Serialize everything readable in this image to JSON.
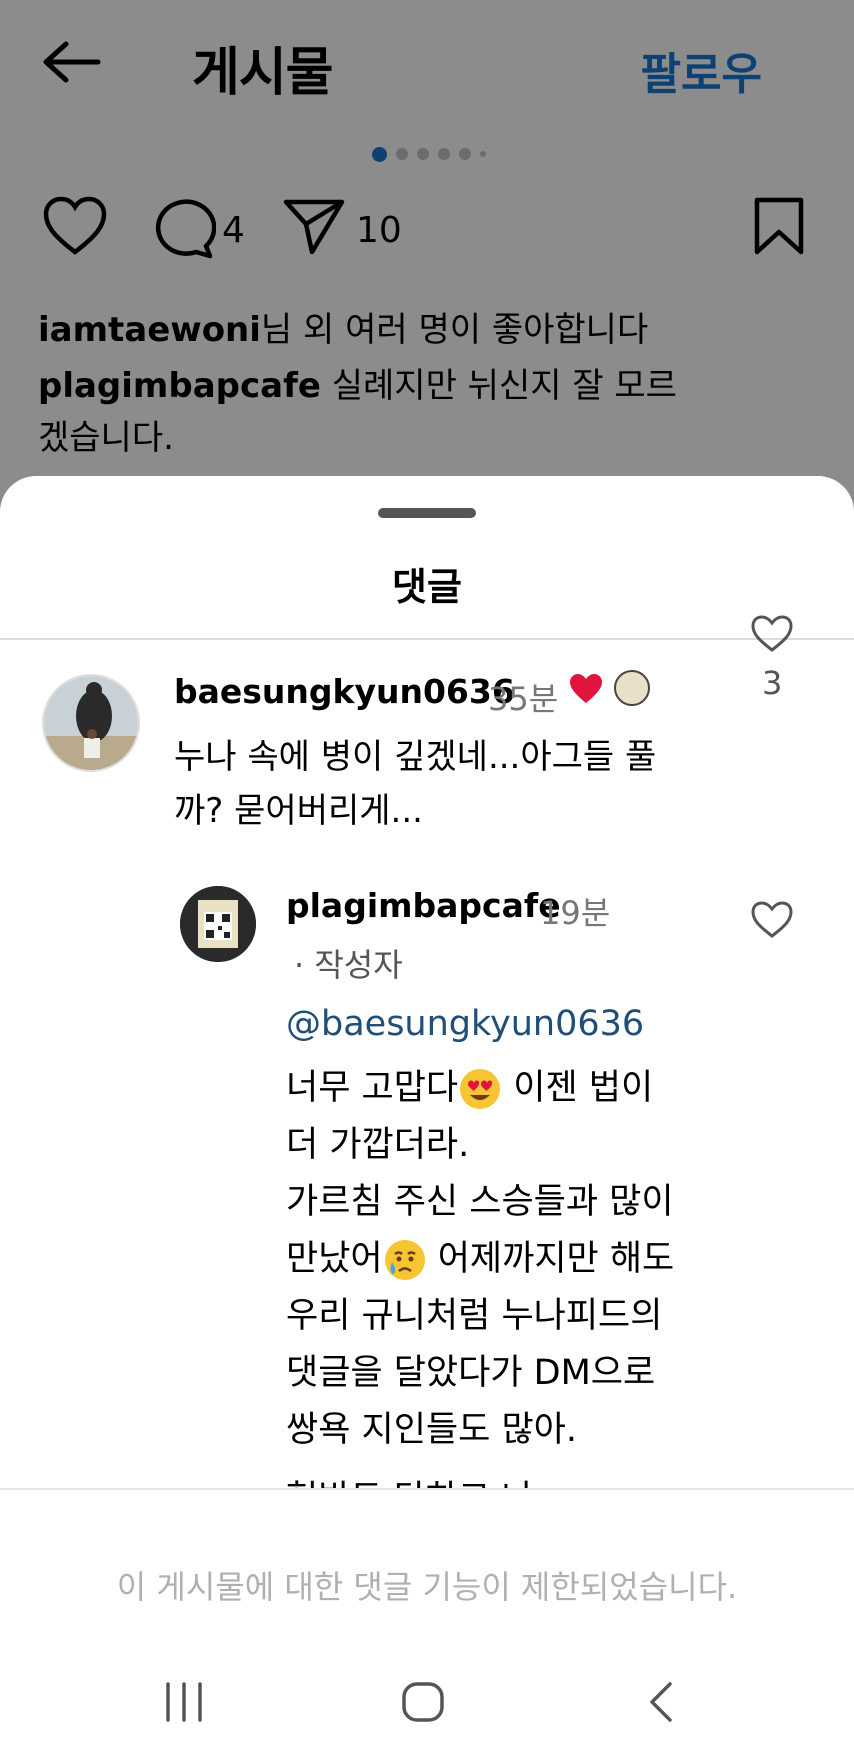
{
  "header": {
    "title": "게시물",
    "follow_label": "팔로우"
  },
  "post": {
    "comment_count": "4",
    "share_count": "10",
    "likes_user": "iamtaewoni",
    "likes_suffix": "님 외 여러 명이 좋아합니다",
    "caption_user": "plagimbapcafe",
    "caption_text": " 실례지만 뉘신지 잘 모르겠습니다."
  },
  "sheet": {
    "title": "댓글",
    "restricted_notice": "이 게시물에 대한 댓글 기능이 제한되었습니다."
  },
  "comments": [
    {
      "username": "baesungkyun0636",
      "time": "35분",
      "text": "누나 속에 병이 깊겠네...아그들 풀까? 묻어버리게...",
      "like_count": "3"
    }
  ],
  "reply": {
    "username": "plagimbapcafe",
    "time": "19분",
    "author_tag": "· 작성자",
    "mention": "@baesungkyun0636",
    "line1_a": "너무 고맙다",
    "line1_b": " 이젠 법이",
    "line2": "더 가깝더라.",
    "line3": "가르침 주신 스승들과 많이",
    "line4_a": "만났어",
    "line4_b": " 어제까지만 해도",
    "line5": "우리 규니처럼  누나피드의",
    "line6": "댓글을 달았다가 DM으로",
    "line7": "쌍욕 지인들도 많아.",
    "line8_partial": "협박도 당하고 나"
  },
  "colors": {
    "accent_blue": "#1877d2",
    "mention_blue": "#1f4e79",
    "heart_red": "#e0143c"
  },
  "icons": [
    "back-arrow-icon",
    "heart-icon",
    "comment-icon",
    "send-icon",
    "bookmark-icon",
    "heart-filled-icon",
    "recent-apps-icon",
    "home-icon",
    "nav-back-icon"
  ]
}
